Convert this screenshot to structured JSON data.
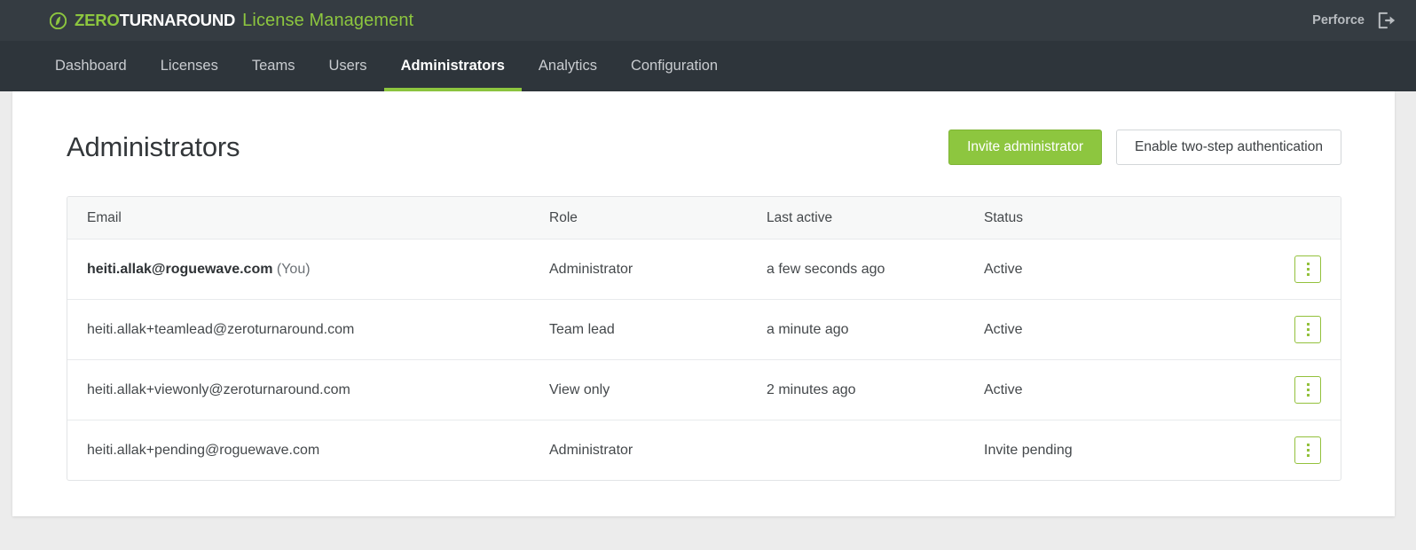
{
  "topbar": {
    "brand_zero": "ZERO",
    "brand_turn": "TURNAROUND",
    "app_title": "License Management",
    "account_name": "Perforce",
    "logo_icon": "zeroturnaround-leaf-icon",
    "logout_icon": "sign-out-icon",
    "accent_green": "#8dc63f",
    "bar_color": "#353c42"
  },
  "nav": {
    "items": [
      {
        "label": "Dashboard",
        "active": false
      },
      {
        "label": "Licenses",
        "active": false
      },
      {
        "label": "Teams",
        "active": false
      },
      {
        "label": "Users",
        "active": false
      },
      {
        "label": "Administrators",
        "active": true
      },
      {
        "label": "Analytics",
        "active": false
      },
      {
        "label": "Configuration",
        "active": false
      }
    ]
  },
  "page": {
    "title": "Administrators",
    "primary_button": "Invite administrator",
    "secondary_button": "Enable two-step authentication"
  },
  "table": {
    "columns": [
      "Email",
      "Role",
      "Last active",
      "Status"
    ],
    "rows": [
      {
        "email": "heiti.allak@roguewave.com",
        "email_suffix": " (You)",
        "is_self": true,
        "role": "Administrator",
        "last_active": "a few seconds ago",
        "status": "Active",
        "action_icon": "kebab-menu-icon"
      },
      {
        "email": "heiti.allak+teamlead@zeroturnaround.com",
        "email_suffix": "",
        "is_self": false,
        "role": "Team lead",
        "last_active": "a minute ago",
        "status": "Active",
        "action_icon": "kebab-menu-icon"
      },
      {
        "email": "heiti.allak+viewonly@zeroturnaround.com",
        "email_suffix": "",
        "is_self": false,
        "role": "View only",
        "last_active": "2 minutes ago",
        "status": "Active",
        "action_icon": "kebab-menu-icon"
      },
      {
        "email": "heiti.allak+pending@roguewave.com",
        "email_suffix": "",
        "is_self": false,
        "role": "Administrator",
        "last_active": "",
        "status": "Invite pending",
        "action_icon": "kebab-menu-icon"
      }
    ]
  }
}
